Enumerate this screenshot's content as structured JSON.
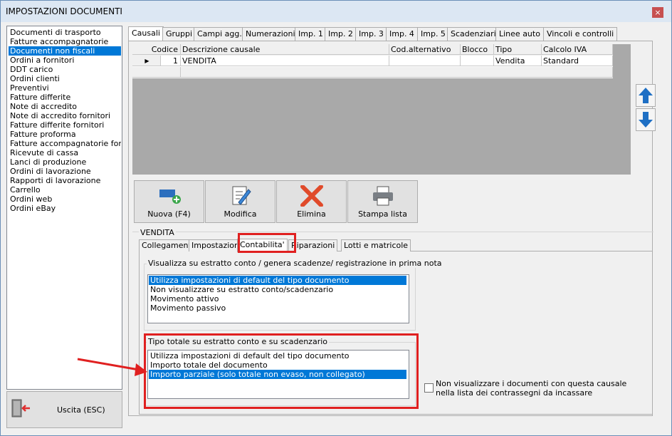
{
  "window": {
    "title": "IMPOSTAZIONI DOCUMENTI",
    "close_label": "×"
  },
  "doc_list": {
    "items": [
      "Documenti di trasporto",
      "Fatture accompagnatorie",
      "Documenti non fiscali",
      "Ordini a fornitori",
      "DDT carico",
      "Ordini clienti",
      "Preventivi",
      "Fatture differite",
      "Note di accredito",
      "Note di accredito fornitori",
      "Fatture differite fornitori",
      "Fatture proforma",
      "Fatture accompagnatorie fornito",
      "Ricevute di cassa",
      "Lanci di produzione",
      "Ordini di lavorazione",
      "Rapporti di lavorazione",
      "Carrello",
      "Ordini web",
      "Ordini eBay"
    ],
    "selected_index": 2
  },
  "exit_button": {
    "label": "Uscita (ESC)",
    "icon": "exit-door-icon"
  },
  "main_tabs": [
    "Causali",
    "Gruppi",
    "Campi agg.",
    "Numerazioni",
    "Imp. 1",
    "Imp. 2",
    "Imp. 3",
    "Imp. 4",
    "Imp. 5",
    "Scadenziario",
    "Linee auto",
    "Vincoli e controlli"
  ],
  "active_main_tab": "Causali",
  "grid": {
    "columns": [
      "Codice",
      "Descrizione causale",
      "Cod.alternativo",
      "Blocco",
      "Tipo",
      "Calcolo IVA"
    ],
    "rows": [
      {
        "indicator": "▶",
        "codice": "1",
        "descrizione": "VENDITA",
        "cod_alternativo": "",
        "blocco": "",
        "tipo": "Vendita",
        "calcolo_iva": "Standard"
      }
    ]
  },
  "move_up_icon": "arrow-up-icon",
  "move_down_icon": "arrow-down-icon",
  "actions": [
    {
      "label": "Nuova (F4)",
      "icon": "new-record-icon"
    },
    {
      "label": "Modifica",
      "icon": "edit-document-icon"
    },
    {
      "label": "Elimina",
      "icon": "delete-x-icon"
    },
    {
      "label": "Stampa lista",
      "icon": "printer-icon"
    }
  ],
  "detail": {
    "group_title": "VENDITA",
    "sub_tabs": [
      "Collegamenti",
      "Impostazioni",
      "Contabilita'",
      "Riparazioni",
      "Lotti e matricole"
    ],
    "active_sub_tab": "Contabilita'",
    "estratto": {
      "title": "Visualizza su estratto conto / genera scadenze/ registrazione  in prima nota",
      "options": [
        "Utilizza impostazioni di default del tipo documento",
        "Non visualizzare su estratto conto/scadenzario",
        "Movimento attivo",
        "Movimento passivo"
      ],
      "selected_index": 0
    },
    "tipo_totale": {
      "title": "Tipo totale su estratto conto e su scadenzario",
      "options": [
        "Utilizza impostazioni di default del tipo documento",
        "Importo totale del documento",
        "Importo parziale (solo totale non evaso, non collegato)"
      ],
      "selected_index": 2
    },
    "checkbox": {
      "label": "Non visualizzare i documenti con questa causale nella lista dei contrassegni da incassare",
      "checked": false
    }
  },
  "colors": {
    "selection": "#0078d7",
    "highlight": "#e02020",
    "title_bar": "#dce7f3"
  }
}
